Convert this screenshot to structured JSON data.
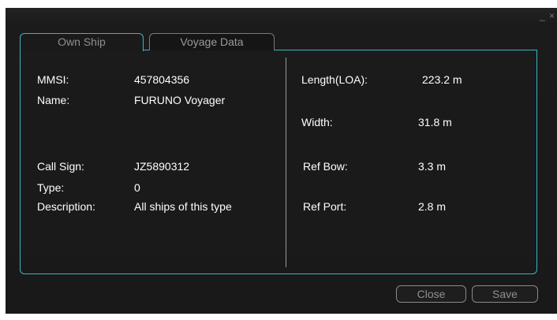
{
  "window": {
    "controls": {
      "minimize": "_",
      "close": "×"
    }
  },
  "tabs": [
    {
      "label": "Own Ship"
    },
    {
      "label": "Voyage Data"
    }
  ],
  "own_ship": {
    "mmsi": {
      "label": "MMSI:",
      "value": "457804356"
    },
    "name": {
      "label": "Name:",
      "value": "FURUNO Voyager"
    },
    "call_sign": {
      "label": "Call Sign:",
      "value": "JZ5890312"
    },
    "type": {
      "label": "Type:",
      "value": "0"
    },
    "description": {
      "label": "Description:",
      "value": "All ships of this type"
    },
    "length": {
      "label": "Length(LOA):",
      "value": "223.2 m"
    },
    "width": {
      "label": "Width:",
      "value": "31.8 m"
    },
    "ref_bow": {
      "label": "Ref Bow:",
      "value": "3.3 m"
    },
    "ref_port": {
      "label": "Ref Port:",
      "value": "2.8 m"
    }
  },
  "buttons": {
    "close": "Close",
    "save": "Save"
  },
  "colors": {
    "background": "#1b1b1b",
    "accent": "#3bb4c6",
    "text": "#ffffff",
    "muted": "#8f8f8f"
  }
}
